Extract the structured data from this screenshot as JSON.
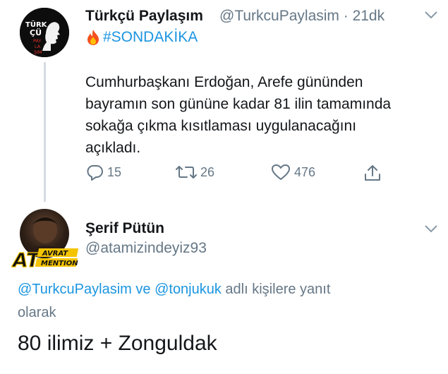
{
  "tweet1": {
    "display_name": "Türkçü Paylaşım",
    "handle": "@TurkcuPaylasim · 21dk",
    "avatar_text": {
      "line1": "TÜRK",
      "line2": "ÇÜ",
      "line3": "PAY",
      "line4": "LA",
      "line5": "ŞIM"
    },
    "hashtag": "#SONDAKİKA",
    "text_lines": [
      "Cumhurbaşkanı Erdoğan, Arefe gününden",
      "bayramın son gününe kadar 81 ilin tamamında",
      "sokağa çıkma kısıtlaması uygulanacağını",
      "açıkladı."
    ],
    "reply_count": "15",
    "retweet_count": "26",
    "like_count": "476"
  },
  "tweet2": {
    "display_name": "Şerif Pütün",
    "handle": "@atamizindeyiz93",
    "badge_text": {
      "main": "AT",
      "top": "AVRAT",
      "bottom": "MENTION"
    },
    "reply_mention1": "@TurkcuPaylasim",
    "reply_and": " ve ",
    "reply_mention2": "@tonjukuk",
    "reply_suffix": " adlı kişilere yanıt",
    "reply_line2": "olarak",
    "text": "80 ilimiz + Zonguldak"
  },
  "colors": {
    "link": "#1b95e0",
    "secondary": "#657786",
    "primary": "#14171a",
    "thread_line": "#d4dbe1"
  },
  "icons": [
    "fire-icon",
    "chevron-down-icon",
    "reply-icon",
    "retweet-icon",
    "heart-icon",
    "share-icon"
  ]
}
